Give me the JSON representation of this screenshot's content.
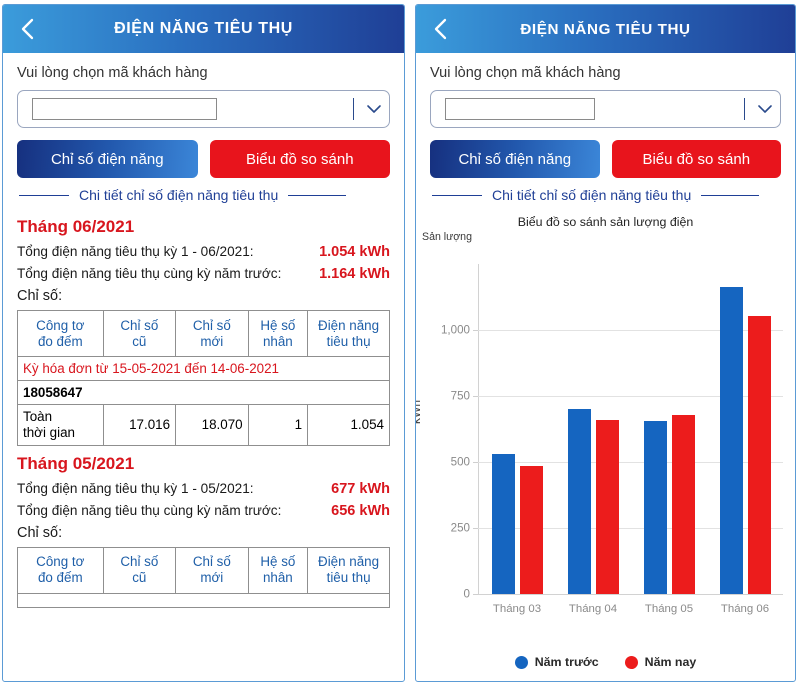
{
  "header": {
    "title": "ĐIỆN NĂNG TIÊU THỤ",
    "back_icon": "chevron-left-icon"
  },
  "selector": {
    "label": "Vui lòng chọn mã khách hàng",
    "value": "",
    "placeholder": "",
    "chevron_icon": "chevron-down-icon"
  },
  "tabs": {
    "index_label": "Chỉ số điện năng",
    "chart_label": "Biểu đồ so sánh"
  },
  "section": {
    "detail_title": "Chi tiết chỉ số điện năng tiêu thụ"
  },
  "colors": {
    "header_from": "#3b9cdb",
    "header_to": "#1f3f96",
    "blue_button": "#1f3f96",
    "red_button": "#e8141c",
    "accent_red": "#d8161e",
    "table_header_text": "#1f5fa8",
    "series_prev": "#1565c0",
    "series_curr": "#ec1c1c"
  },
  "months": [
    {
      "title": "Tháng 06/2021",
      "total_label": "Tổng điện năng tiêu thụ kỳ 1 - 06/2021:",
      "total_value": "1.054 kWh",
      "prev_label": "Tổng điện năng tiêu thụ cùng kỳ năm trước:",
      "prev_value": "1.164 kWh",
      "chiso_label": "Chỉ số:",
      "columns": [
        "Công tơ đo đếm",
        "Chỉ số cũ",
        "Chỉ số mới",
        "Hệ số nhân",
        "Điện năng tiêu thụ"
      ],
      "columns_split": [
        [
          "Công tơ",
          "đo đếm"
        ],
        [
          "Chỉ số",
          "cũ"
        ],
        [
          "Chỉ số",
          "mới"
        ],
        [
          "Hệ số",
          "nhân"
        ],
        [
          "Điện năng",
          "tiêu thụ"
        ]
      ],
      "period": "Kỳ hóa đơn từ 15-05-2021 đến 14-06-2021",
      "meter_no": "18058647",
      "row": {
        "name_line1": "Toàn",
        "name_line2": "thời gian",
        "old_index": "17.016",
        "new_index": "18.070",
        "multiplier": "1",
        "consumption": "1.054"
      }
    },
    {
      "title": "Tháng 05/2021",
      "total_label": "Tổng điện năng tiêu thụ kỳ 1 - 05/2021:",
      "total_value": "677 kWh",
      "prev_label": "Tổng điện năng tiêu thụ cùng kỳ năm trước:",
      "prev_value": "656 kWh",
      "chiso_label": "Chỉ số:",
      "columns": [
        "Công tơ đo đếm",
        "Chỉ số cũ",
        "Chỉ số mới",
        "Hệ số nhân",
        "Điện năng tiêu thụ"
      ],
      "columns_split": [
        [
          "Công tơ",
          "đo đếm"
        ],
        [
          "Chỉ số",
          "cũ"
        ],
        [
          "Chỉ số",
          "mới"
        ],
        [
          "Hệ số",
          "nhân"
        ],
        [
          "Điện năng",
          "tiêu thụ"
        ]
      ]
    }
  ],
  "chart_data": {
    "type": "bar",
    "title": "Biểu đồ so sánh sản lượng điện",
    "unit_top_label": "Sản lượng",
    "ylabel": "kWh",
    "xlabel": "",
    "categories": [
      "Tháng 03",
      "Tháng 04",
      "Tháng 05",
      "Tháng 06"
    ],
    "series": [
      {
        "name": "Năm trước",
        "color": "#1565c0",
        "values": [
          530,
          700,
          656,
          1164
        ]
      },
      {
        "name": "Năm nay",
        "color": "#ec1c1c",
        "values": [
          485,
          660,
          677,
          1054
        ]
      }
    ],
    "yticks": [
      "0",
      "250",
      "500",
      "750",
      "1,000"
    ],
    "ylim": [
      0,
      1250
    ],
    "grid": true,
    "legend_position": "bottom"
  }
}
